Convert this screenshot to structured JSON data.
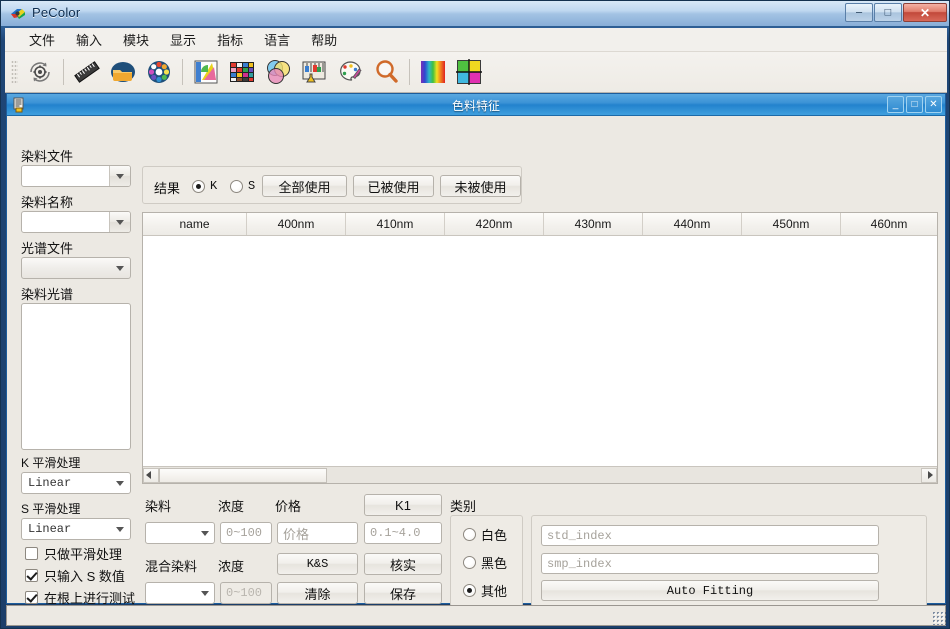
{
  "window": {
    "title": "PeColor",
    "icon": "pecolor-logo-icon",
    "minimize": "–",
    "maximize": "□",
    "close": "✕"
  },
  "menubar": {
    "items": [
      {
        "label": "文件",
        "name": "menu-file"
      },
      {
        "label": "输入",
        "name": "menu-input"
      },
      {
        "label": "模块",
        "name": "menu-module"
      },
      {
        "label": "显示",
        "name": "menu-display"
      },
      {
        "label": "指标",
        "name": "menu-metrics"
      },
      {
        "label": "语言",
        "name": "menu-language"
      },
      {
        "label": "帮助",
        "name": "menu-help"
      }
    ]
  },
  "toolbar": {
    "buttons": [
      {
        "icon": "settings-gear-refresh-icon"
      },
      {
        "icon": "ruler-icon"
      },
      {
        "icon": "folder-open-icon"
      },
      {
        "icon": "color-wheel-icon"
      },
      {
        "icon": "color-palette-fan-icon"
      },
      {
        "icon": "color-chart-grid-icon"
      },
      {
        "icon": "color-mixing-circles-icon"
      },
      {
        "icon": "lab-flask-icon"
      },
      {
        "icon": "paint-palette-icon"
      },
      {
        "icon": "magnifier-icon"
      },
      {
        "icon": "spectrum-bars-icon"
      },
      {
        "icon": "color-quadrant-icon"
      }
    ]
  },
  "mdi": {
    "title": "色料特征",
    "icon": "colorant-document-icon",
    "minimize": "_",
    "maximize": "□",
    "close": "✕"
  },
  "left_panel": {
    "dye_file_label": "染料文件",
    "dye_file_value": "",
    "dye_name_label": "染料名称",
    "dye_name_value": "",
    "spectrum_file_label": "光谱文件",
    "spectrum_file_value": "",
    "dye_spectrum_label": "染料光谱",
    "k_smooth_label": "K 平滑处理",
    "k_smooth_value": "Linear",
    "s_smooth_label": "S 平滑处理",
    "s_smooth_value": "Linear",
    "checkboxes": [
      {
        "label": "只做平滑处理",
        "checked": false,
        "name": "checkbox-smooth-only"
      },
      {
        "label": "只输入 S 数值",
        "checked": true,
        "name": "checkbox-s-value-only"
      },
      {
        "label": "在根上进行测试",
        "checked": true,
        "name": "checkbox-test-on-root"
      }
    ]
  },
  "result_bar": {
    "label": "结果",
    "radios": [
      {
        "label": "K",
        "selected": true,
        "name": "radio-result-k"
      },
      {
        "label": "S",
        "selected": false,
        "name": "radio-result-s"
      }
    ],
    "buttons": [
      {
        "label": "全部使用",
        "name": "use-all-button"
      },
      {
        "label": "已被使用",
        "name": "used-button"
      },
      {
        "label": "未被使用",
        "name": "unused-button"
      }
    ]
  },
  "table": {
    "columns": [
      "name",
      "400nm",
      "410nm",
      "420nm",
      "430nm",
      "440nm",
      "450nm",
      "460nm"
    ],
    "rows": []
  },
  "bottom_form": {
    "dye_label": "染料",
    "dye_value": "",
    "concentration_label": "浓度",
    "concentration_placeholder": "0~100",
    "price_label": "价格",
    "price_placeholder": "价格",
    "k1_button": "K1",
    "k1_range_placeholder": "0.1~4.0",
    "mixed_dye_label": "混合染料",
    "mixed_dye_value": "",
    "concentration2_label": "浓度",
    "concentration2_placeholder": "0~100",
    "ks_button": "K&S",
    "verify_button": "核实",
    "clear_button": "清除",
    "save_button": "保存"
  },
  "category": {
    "label": "类别",
    "radios": [
      {
        "label": "白色",
        "selected": false,
        "name": "radio-category-white"
      },
      {
        "label": "黑色",
        "selected": false,
        "name": "radio-category-black"
      },
      {
        "label": "其他",
        "selected": true,
        "name": "radio-category-other"
      }
    ],
    "std_index_placeholder": "std_index",
    "std_index_value": "",
    "smp_index_placeholder": "smp_index",
    "smp_index_value": "",
    "auto_fitting_button": "Auto Fitting"
  },
  "colors": {
    "frame_blue": "#1b3e6a",
    "mdi_title_blue": "#2382cd",
    "panel_bg": "#ece9e3",
    "accent_close_red": "#c2483a"
  }
}
